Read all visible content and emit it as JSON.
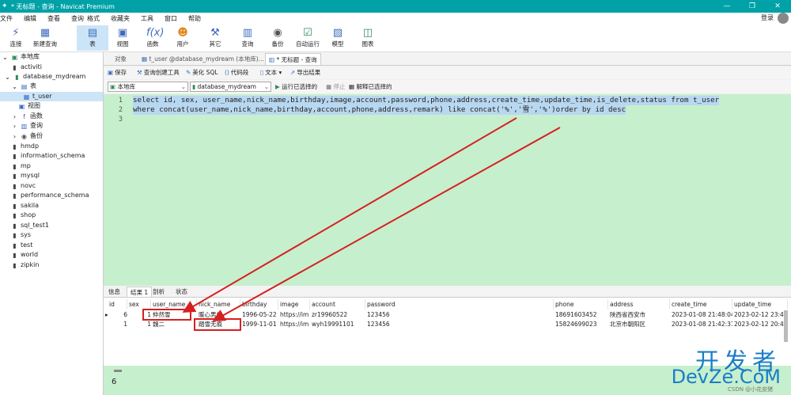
{
  "window": {
    "title": "* 无标题 - 查询 - Navicat Premium",
    "controls": [
      "—",
      "❐",
      "✕"
    ]
  },
  "menu": {
    "items": [
      "文件",
      "编辑",
      "查看",
      "查询",
      "格式",
      "收藏夹",
      "工具",
      "窗口",
      "帮助"
    ],
    "login": "登录"
  },
  "toolbar": {
    "items": [
      {
        "label": "连接",
        "icon": "connect-icon"
      },
      {
        "label": "新建查询",
        "icon": "new-query-icon"
      },
      {
        "label": "表",
        "icon": "table-icon"
      },
      {
        "label": "视图",
        "icon": "view-icon"
      },
      {
        "label": "函数",
        "icon": "function-icon"
      },
      {
        "label": "用户",
        "icon": "user-icon"
      },
      {
        "label": "其它",
        "icon": "other-icon"
      },
      {
        "label": "查询",
        "icon": "query-icon"
      },
      {
        "label": "备份",
        "icon": "backup-icon"
      },
      {
        "label": "自动运行",
        "icon": "auto-run-icon"
      },
      {
        "label": "模型",
        "icon": "model-icon"
      },
      {
        "label": "图表",
        "icon": "chart-icon"
      }
    ]
  },
  "tree": {
    "root": "本地库",
    "items": [
      "activiti",
      "database_mydream",
      "表",
      "t_user",
      "视图",
      "函数",
      "查询",
      "备份",
      "hmdp",
      "information_schema",
      "mp",
      "mysql",
      "novc",
      "performance_schema",
      "sakila",
      "shop",
      "sql_test1",
      "sys",
      "test",
      "world",
      "zipkin"
    ]
  },
  "tabs": [
    "对象",
    "t_user @database_mydream (本地库)...",
    "* 无标题 - 查询"
  ],
  "query_toolbar": [
    "保存",
    "查询创建工具",
    "美化 SQL",
    "代码段",
    "文本",
    "导出结果"
  ],
  "connection": {
    "server": "本地库",
    "database": "database_mydream",
    "run_selected": "运行已选择的",
    "stop": "停止",
    "explain": "解释已选择的"
  },
  "editor": {
    "lines": [
      {
        "n": "1",
        "text": "select id, sex, user_name,nick_name,birthday,image,account,password,phone,address,create_time,update_time,is_delete,status from t_user"
      },
      {
        "n": "2",
        "text": "where concat(user_name,nick_name,birthday,account,phone,address,remark) like concat('%','雪','%')order by id desc"
      },
      {
        "n": "3",
        "text": ""
      }
    ]
  },
  "result_tabs": [
    "信息",
    "结果 1",
    "剖析",
    "状态"
  ],
  "grid": {
    "columns": [
      "id",
      "sex",
      "user_name",
      "nick_name",
      "birthday",
      "image",
      "account",
      "password",
      "phone",
      "address",
      "create_time",
      "update_time"
    ],
    "rows": [
      [
        "6",
        "1",
        "仲然雪",
        "暖心男生",
        "1996-05-22",
        "https://im",
        "zr19960522",
        "123456",
        "18691603452",
        "陕西省西安市",
        "2023-01-08 21:48:04",
        "2023-02-12 23:4"
      ],
      [
        "1",
        "1",
        "魏二",
        "踏雪无痕",
        "1999-11-01",
        "https://im",
        "wyh19991101",
        "123456",
        "15824699023",
        "北京市朝阳区",
        "2023-01-08 21:42:31",
        "2023-02-12 20:4"
      ]
    ]
  },
  "status": {
    "number": "6"
  },
  "watermark": {
    "line1": "开发者",
    "line2": "DevZe.CoM",
    "credit": "CSDN @小花皮猪"
  },
  "colors": {
    "titlebar": "#00a2a7",
    "editor_bg": "#c6efce",
    "highlight": "#d62020"
  }
}
